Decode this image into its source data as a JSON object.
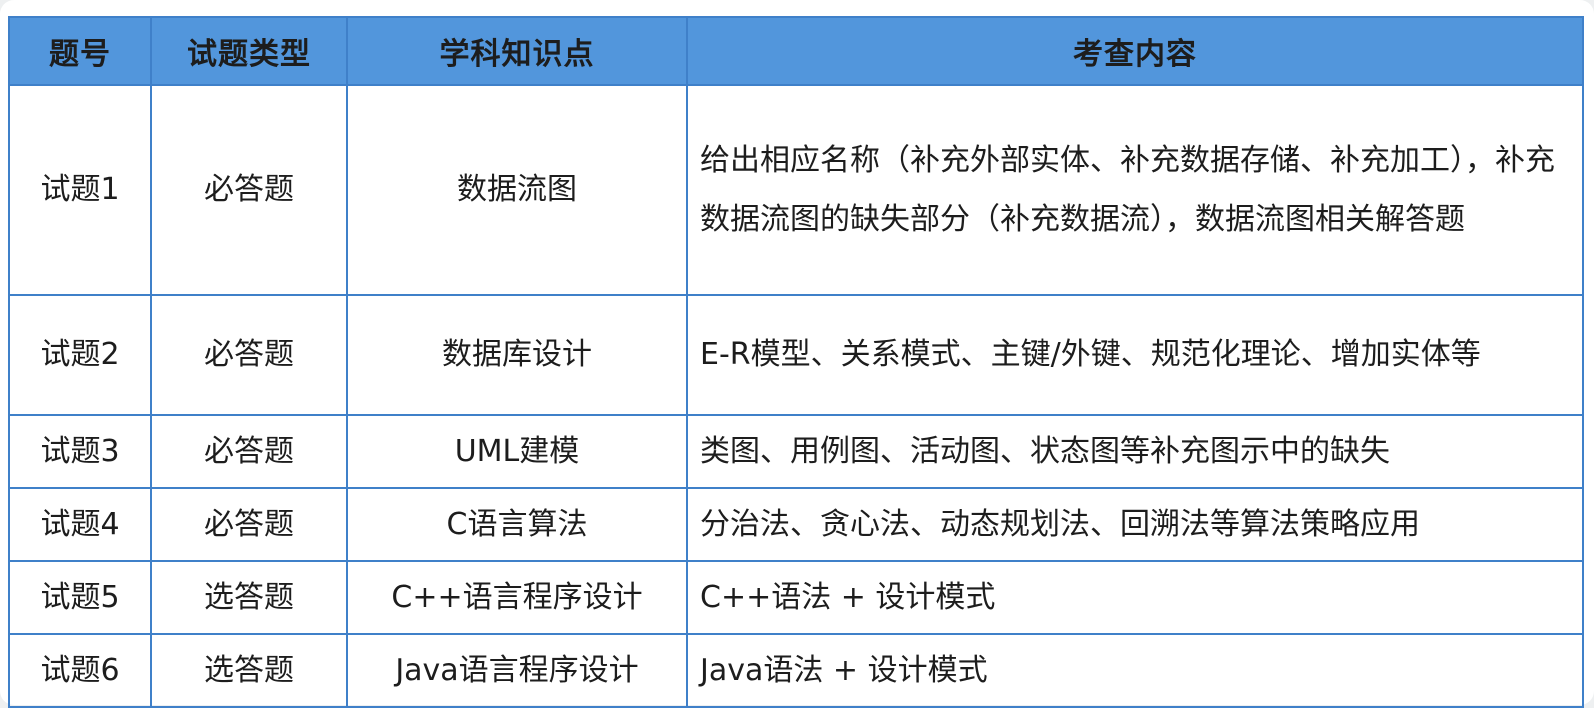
{
  "headers": {
    "number": "题号",
    "type": "试题类型",
    "knowledge": "学科知识点",
    "content": "考查内容"
  },
  "rows": [
    {
      "number": "试题1",
      "type": "必答题",
      "knowledge": "数据流图",
      "content": "给出相应名称（补充外部实体、补充数据存储、补充加工），补充数据流图的缺失部分（补充数据流），数据流图相关解答题"
    },
    {
      "number": "试题2",
      "type": "必答题",
      "knowledge": "数据库设计",
      "content": "E-R模型、关系模式、主键/外键、规范化理论、增加实体等"
    },
    {
      "number": "试题3",
      "type": "必答题",
      "knowledge": "UML建模",
      "content": "类图、用例图、活动图、状态图等补充图示中的缺失"
    },
    {
      "number": "试题4",
      "type": "必答题",
      "knowledge": "C语言算法",
      "content": "分治法、贪心法、动态规划法、回溯法等算法策略应用"
    },
    {
      "number": "试题5",
      "type": "选答题",
      "knowledge": "C++语言程序设计",
      "content": "C++语法 + 设计模式"
    },
    {
      "number": "试题6",
      "type": "选答题",
      "knowledge": "Java语言程序设计",
      "content": "Java语法 + 设计模式"
    }
  ],
  "colors": {
    "header_bg": "#5296dc",
    "border": "#3f80c9",
    "text": "#1d1d1d",
    "page_bg": "#eef0f1"
  }
}
